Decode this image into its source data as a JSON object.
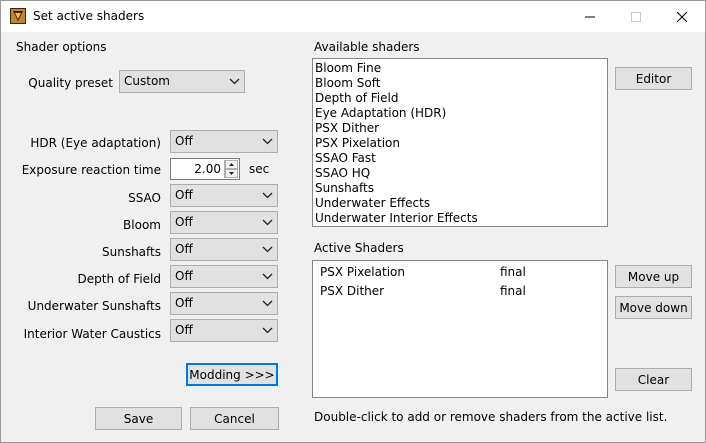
{
  "window": {
    "title": "Set active shaders",
    "controls": {
      "minimize": "—",
      "maximize": "☐",
      "close": "✕"
    }
  },
  "shader_options": {
    "heading": "Shader options",
    "quality_preset": {
      "label": "Quality preset",
      "value": "Custom"
    },
    "hdr": {
      "label": "HDR (Eye adaptation)",
      "value": "Off"
    },
    "exposure": {
      "label": "Exposure reaction time",
      "value": "2.00",
      "unit": "sec"
    },
    "ssao": {
      "label": "SSAO",
      "value": "Off"
    },
    "bloom": {
      "label": "Bloom",
      "value": "Off"
    },
    "sunshafts": {
      "label": "Sunshafts",
      "value": "Off"
    },
    "depth_of_field": {
      "label": "Depth of Field",
      "value": "Off"
    },
    "underwater_sunshafts": {
      "label": "Underwater Sunshafts",
      "value": "Off"
    },
    "interior_water_caustics": {
      "label": "Interior Water Caustics",
      "value": "Off"
    },
    "modding_button": "Modding >>>",
    "save_button": "Save",
    "cancel_button": "Cancel"
  },
  "available": {
    "heading": "Available shaders",
    "items": [
      "Bloom Fine",
      "Bloom Soft",
      "Depth of Field",
      "Eye Adaptation (HDR)",
      "PSX Dither",
      "PSX Pixelation",
      "SSAO Fast",
      "SSAO HQ",
      "Sunshafts",
      "Underwater Effects",
      "Underwater Interior Effects"
    ],
    "editor_button": "Editor"
  },
  "active": {
    "heading": "Active Shaders",
    "items": [
      {
        "name": "PSX Pixelation",
        "tag": "final"
      },
      {
        "name": "PSX Dither",
        "tag": "final"
      }
    ],
    "move_up_button": "Move up",
    "move_down_button": "Move down",
    "clear_button": "Clear"
  },
  "hint": "Double-click to add or remove shaders from the active list.",
  "icons": {
    "app": "app-icon",
    "dropdown": "chevron-down-icon",
    "spin_up": "spin-up-icon",
    "spin_down": "spin-down-icon"
  },
  "colors": {
    "window_bg": "#f0f0f0",
    "accent": "#0078d7",
    "control_bg": "#e1e1e1",
    "control_border": "#adadad"
  }
}
